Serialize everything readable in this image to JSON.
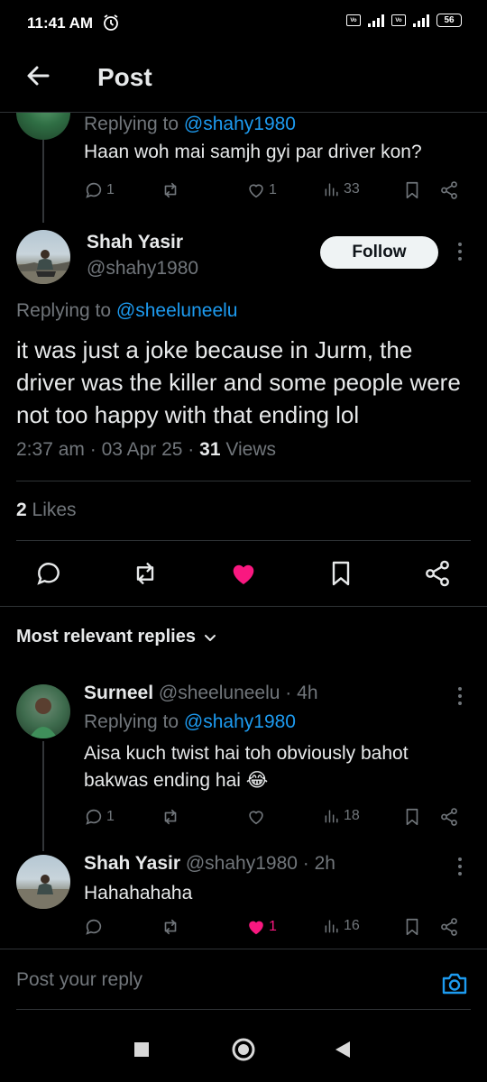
{
  "status_bar": {
    "time": "11:41 AM",
    "battery": "56",
    "network": "4G",
    "volte": "Vo LTE"
  },
  "header": {
    "title": "Post"
  },
  "parent_reply": {
    "replying_prefix": "Replying to",
    "replying_handle": "@shahy1980",
    "text": "Haan woh mai samjh gyi par driver kon?",
    "stats": {
      "replies": "1",
      "reposts": "",
      "likes": "1",
      "views": "33"
    }
  },
  "main_post": {
    "name": "Shah Yasir",
    "handle": "@shahy1980",
    "follow_label": "Follow",
    "replying_prefix": "Replying to",
    "replying_handle": "@sheeluneelu",
    "text": "it was just a joke because in Jurm, the driver was the killer and some people were not too happy with that ending lol",
    "time": "2:37 am",
    "date": "03 Apr 25",
    "views_count": "31",
    "views_label": "Views",
    "likes_count": "2",
    "likes_label": "Likes"
  },
  "replies_section": {
    "sort_label": "Most relevant replies"
  },
  "replies": [
    {
      "name": "Surneel",
      "handle": "@sheeluneelu",
      "age": "4h",
      "replying_prefix": "Replying to",
      "replying_handle": "@shahy1980",
      "text": "Aisa kuch twist hai toh obviously bahot bakwas ending hai 😂",
      "stats": {
        "replies": "1",
        "reposts": "",
        "likes": "",
        "views": "18"
      }
    },
    {
      "name": "Shah Yasir",
      "handle": "@shahy1980",
      "age": "2h",
      "text": "Hahahahaha",
      "stats": {
        "replies": "",
        "reposts": "",
        "likes": "1",
        "views": "16"
      }
    }
  ],
  "compose": {
    "placeholder": "Post your reply"
  },
  "colors": {
    "accent": "#1d9bf0",
    "like": "#f91880",
    "muted": "#71767b",
    "text": "#e7e9ea",
    "background": "#000000"
  }
}
